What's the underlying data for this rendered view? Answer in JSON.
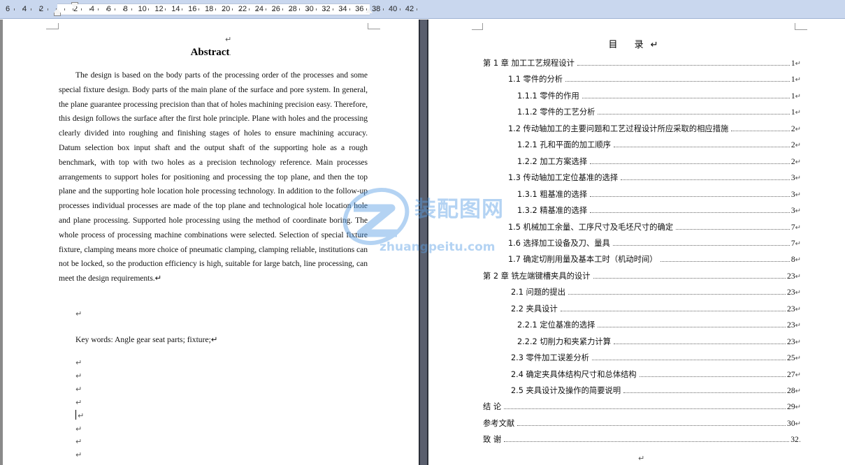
{
  "ruler": {
    "left_numbers": [
      "6",
      "4",
      "2"
    ],
    "right_numbers": [
      "2",
      "4",
      "6",
      "8",
      "10",
      "12",
      "14",
      "16",
      "18",
      "20",
      "22",
      "24",
      "26",
      "28",
      "30",
      "32",
      "34",
      "36",
      "38",
      "40",
      "42"
    ]
  },
  "left_page": {
    "top_mark": "↵",
    "title": "Abstract",
    "title_mark": ".",
    "body": "The design is based on the body parts of the processing order of the processes and some special fixture design. Body parts of the main plane of the surface and pore system. In general, the plane guarantee processing precision than that of holes machining precision easy. Therefore, this design follows the surface after the first hole principle. Plane with holes and the processing clearly divided into roughing and finishing stages of holes to ensure machining accuracy. Datum selection box input shaft and the output shaft of the supporting hole as a rough benchmark, with top with two holes as a precision technology reference. Main processes arrangements to support holes for positioning and processing the top plane, and then the top plane and the supporting hole location hole processing technology. In addition to the follow-up processes individual processes are made of the top plane and technological hole location hole and plane processing. Supported hole processing using the method of coordinate boring. The whole process of processing machine combinations were selected. Selection of special fixture fixture, clamping means more choice of pneumatic clamping, clamping reliable, institutions can not be locked, so the production efficiency is high, suitable for large batch, line processing, can meet the design requirements.↵",
    "empty_mark": "↵",
    "keywords": "Key words: Angle gear seat parts; fixture;↵"
  },
  "watermark": {
    "cn": "装配图网",
    "en": "zhuangpeitu.com"
  },
  "right_page": {
    "toc_title": "目  录↵",
    "entries": [
      {
        "text": "第 1 章  加工工艺规程设计",
        "page": "1",
        "mark": "↵"
      },
      {
        "text": "1.1  零件的分析",
        "page": "1",
        "mark": "↵"
      },
      {
        "text": "1.1.1  零件的作用",
        "page": "1",
        "mark": "↵"
      },
      {
        "text": "1.1.2  零件的工艺分析",
        "page": "1",
        "mark": "↵"
      },
      {
        "text": "1.2  传动轴加工的主要问题和工艺过程设计所应采取的相应措施",
        "page": "2",
        "mark": "↵"
      },
      {
        "text": "1.2.1  孔和平面的加工顺序",
        "page": "2",
        "mark": "↵"
      },
      {
        "text": "1.2.2 加工方案选择",
        "page": "2",
        "mark": "↵"
      },
      {
        "text": "1.3  传动轴加工定位基准的选择",
        "page": "3",
        "mark": "↵"
      },
      {
        "text": "1.3.1  粗基准的选择",
        "page": "3",
        "mark": "↵"
      },
      {
        "text": "1.3.2  精基准的选择",
        "page": "3",
        "mark": "↵"
      },
      {
        "text": "1.5  机械加工余量、工序尺寸及毛坯尺寸的确定",
        "page": "7",
        "mark": "↵"
      },
      {
        "text": "1.6 选择加工设备及刀、量具",
        "page": "7",
        "mark": "↵"
      },
      {
        "text": "1.7 确定切削用量及基本工时（机动时间）",
        "page": "8",
        "mark": "↵"
      },
      {
        "text": "第 2 章  铣左端键槽夹具的设计",
        "page": "23",
        "mark": "↵"
      },
      {
        "text": "2.1   问题的提出",
        "page": "23",
        "mark": "↵"
      },
      {
        "text": "2.2   夹具设计",
        "page": "23",
        "mark": "↵"
      },
      {
        "text": "2.2.1 定位基准的选择",
        "page": "23",
        "mark": "↵"
      },
      {
        "text": "2.2.2 切削力和夹紧力计算",
        "page": "23",
        "mark": "↵"
      },
      {
        "text": "2.3 零件加工误差分析",
        "page": "25",
        "mark": "↵"
      },
      {
        "text": "2.4 确定夹具体结构尺寸和总体结构",
        "page": "27",
        "mark": "↵"
      },
      {
        "text": "2.5 夹具设计及操作的简要说明",
        "page": "28",
        "mark": "↵"
      },
      {
        "text": "结  论",
        "page": "29",
        "mark": "↵"
      },
      {
        "text": "参考文献",
        "page": "30",
        "mark": "↵"
      },
      {
        "text": "致      谢",
        "page": "32",
        "mark": "."
      }
    ],
    "bottom_mark": "↵"
  }
}
